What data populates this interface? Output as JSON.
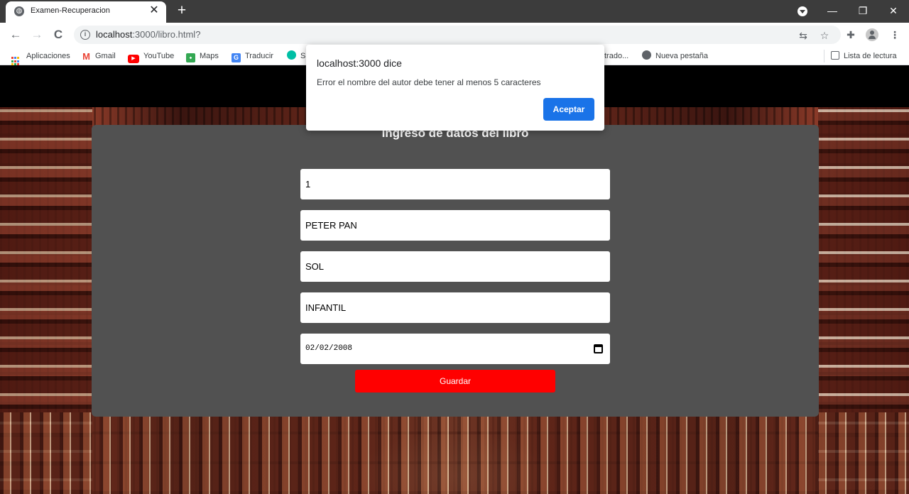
{
  "browser": {
    "tab": {
      "title": "Examen-Recuperacion",
      "close": "✕"
    },
    "new_tab": "+",
    "window_controls": {
      "minimize": "—",
      "restore": "❐",
      "close": "✕"
    },
    "nav": {
      "back": "←",
      "forward": "→",
      "reload": "C"
    },
    "address": {
      "host": "localhost",
      "rest": ":3000/libro.html?"
    },
    "bookmarks": [
      {
        "label": "Aplicaciones",
        "icon": "apps-grid-icon"
      },
      {
        "label": "Gmail",
        "icon": "gmail-icon"
      },
      {
        "label": "YouTube",
        "icon": "youtube-icon"
      },
      {
        "label": "Maps",
        "icon": "maps-icon"
      },
      {
        "label": "Traducir",
        "icon": "translate-icon"
      },
      {
        "label": "S",
        "icon": "site-icon"
      },
      {
        "label": "trado...",
        "icon": ""
      },
      {
        "label": "Nueva pestaña",
        "icon": "globe-icon"
      }
    ],
    "reading_list": "Lista de lectura",
    "colors": {
      "titlebar": "#3c3c3c",
      "omnibox": "#f1f3f4",
      "gmail": "#ea4335",
      "youtube": "#ff0000",
      "maps": "#34a853",
      "translate": "#4285f4",
      "site": "#00bfa5"
    }
  },
  "page": {
    "form_title": "Ingreso de datos del libro",
    "fields": {
      "id": "1",
      "titulo": "PETER PAN",
      "autor": "SOL",
      "genero": "INFANTIL",
      "fecha": "02/02/2008"
    },
    "save_label": "Guardar",
    "colors": {
      "card": "#515151",
      "button": "#ff0000"
    }
  },
  "alert": {
    "title": "localhost:3000 dice",
    "message": "Error el nombre del autor debe tener al menos 5 caracteres",
    "ok_label": "Aceptar",
    "color": "#1a73e8"
  }
}
